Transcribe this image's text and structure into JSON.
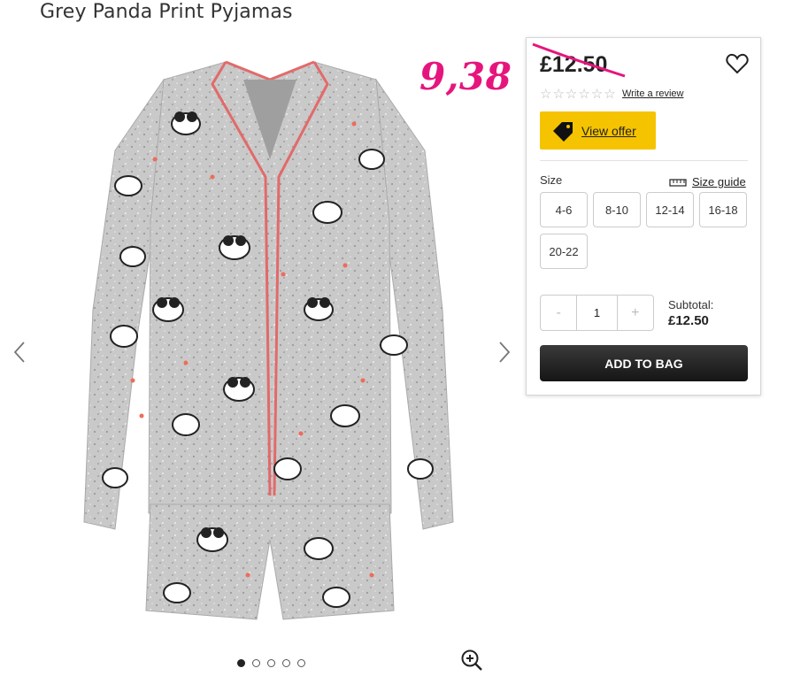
{
  "page": {
    "title": "Grey Panda Print Pyjamas"
  },
  "gallery": {
    "prev_icon": "chevron-left-icon",
    "next_icon": "chevron-right-icon",
    "zoom_icon": "zoom-in-icon",
    "slide_count": 5,
    "active_slide": 1
  },
  "product": {
    "old_price": "£12.50",
    "annotated_price": "9,38",
    "rating_stars": 0,
    "review_link": "Write a review",
    "offer_button": "View offer",
    "size_label": "Size",
    "size_guide": "Size guide",
    "sizes": [
      "4-6",
      "8-10",
      "12-14",
      "16-18",
      "20-22"
    ],
    "quantity": "1",
    "qty_minus": "-",
    "qty_plus": "+",
    "subtotal_label": "Subtotal:",
    "subtotal_value": "£12.50",
    "add_to_bag": "ADD TO BAG"
  },
  "colors": {
    "offer_bg": "#f5c300",
    "annotation": "#e6157d",
    "button_dark": "#1f1f1f"
  }
}
